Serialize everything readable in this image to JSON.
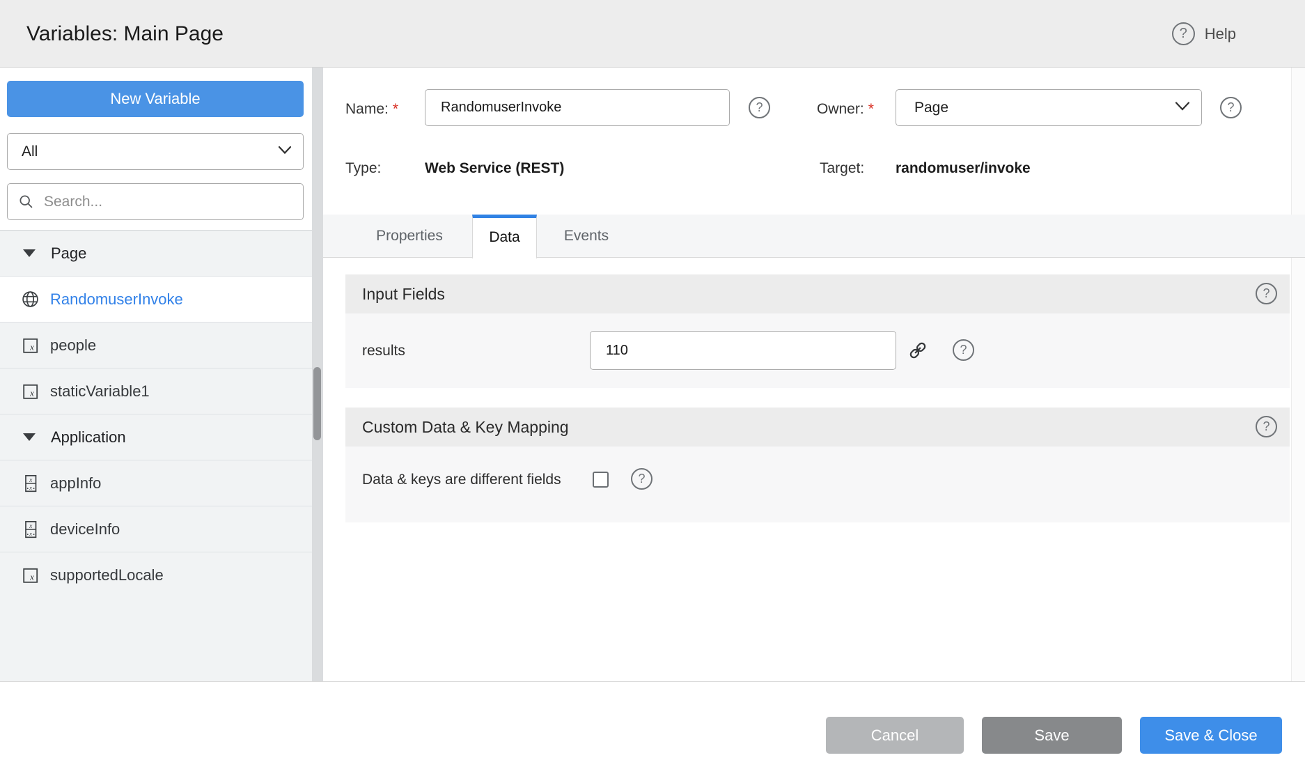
{
  "header": {
    "title": "Variables: Main Page",
    "help_label": "Help"
  },
  "sidebar": {
    "new_variable_label": "New Variable",
    "filter_value": "All",
    "search_placeholder": "Search...",
    "groups": [
      {
        "label": "Page",
        "items": [
          {
            "name": "RandomuserInvoke",
            "icon": "web-service-globe-icon",
            "selected": true
          },
          {
            "name": "people",
            "icon": "variable-icon",
            "selected": false
          },
          {
            "name": "staticVariable1",
            "icon": "variable-icon",
            "selected": false
          }
        ]
      },
      {
        "label": "Application",
        "items": [
          {
            "name": "appInfo",
            "icon": "builtin-variable-icon",
            "selected": false
          },
          {
            "name": "deviceInfo",
            "icon": "builtin-variable-icon",
            "selected": false
          },
          {
            "name": "supportedLocale",
            "icon": "variable-icon",
            "selected": false
          }
        ]
      }
    ]
  },
  "form": {
    "name_label": "Name:",
    "required_marker": "*",
    "name_value": "RandomuserInvoke",
    "owner_label": "Owner:",
    "owner_value": "Page",
    "type_label": "Type:",
    "type_value": "Web Service (REST)",
    "target_label": "Target:",
    "target_value": "randomuser/invoke"
  },
  "tabs": [
    {
      "label": "Properties",
      "active": false
    },
    {
      "label": "Data",
      "active": true
    },
    {
      "label": "Events",
      "active": false
    }
  ],
  "sections": {
    "input_fields": {
      "title": "Input Fields",
      "rows": [
        {
          "label": "results",
          "value": "110"
        }
      ]
    },
    "custom_mapping": {
      "title": "Custom Data & Key Mapping",
      "checkbox_label": "Data & keys are different fields",
      "checkbox_checked": false
    }
  },
  "footer": {
    "cancel_label": "Cancel",
    "save_label": "Save",
    "save_close_label": "Save & Close"
  },
  "colors": {
    "accent_blue": "#4a93e5",
    "selected_item_blue": "#3181e8",
    "tab_active_border": "#3182e4",
    "save_close_bg": "#3e8ee9",
    "save_bg": "#87898b",
    "cancel_bg": "#b4b6b8",
    "required_red": "#d93025"
  }
}
